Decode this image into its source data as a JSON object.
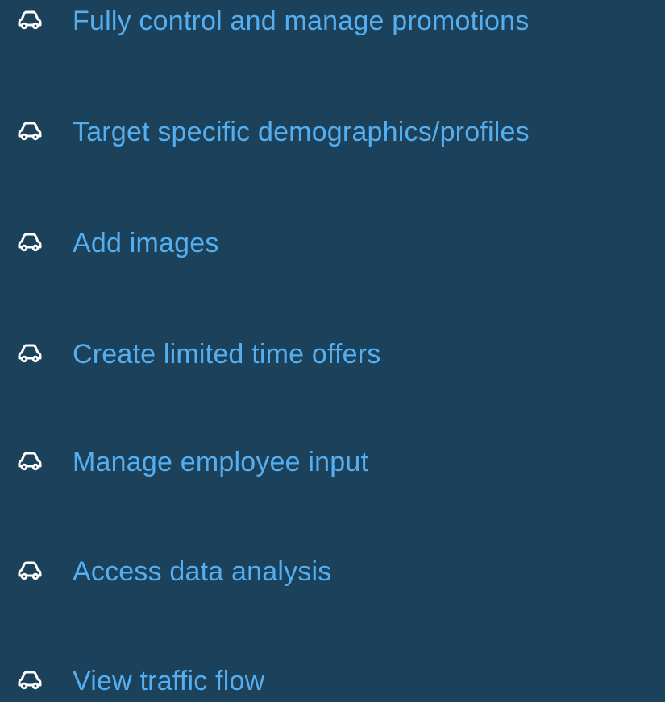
{
  "colors": {
    "background": "#1c425b",
    "text": "#55aef0",
    "icon": "#ffffff"
  },
  "icon": "car-icon",
  "features": [
    {
      "label": "Fully control and manage promotions"
    },
    {
      "label": "Target specific demographics/profiles"
    },
    {
      "label": "Add images"
    },
    {
      "label": "Create limited time offers"
    },
    {
      "label": "Manage employee input"
    },
    {
      "label": "Access data analysis"
    },
    {
      "label": "View traffic flow"
    }
  ]
}
